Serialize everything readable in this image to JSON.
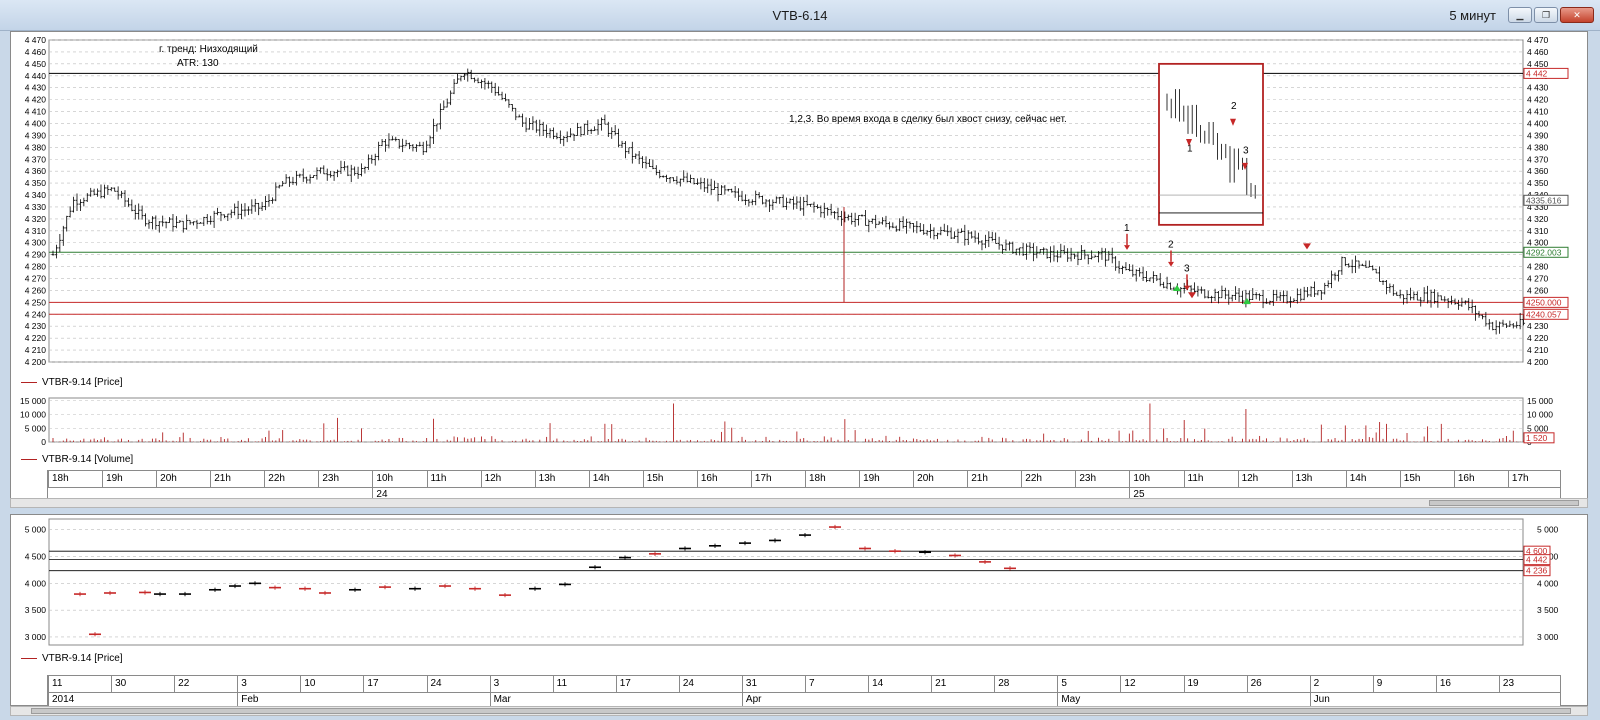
{
  "window": {
    "title": "VTB-6.14",
    "period": "5 минут",
    "controls": [
      "minimize",
      "maximize",
      "close"
    ]
  },
  "main_chart": {
    "annotation_trend": "г. тренд: Низходящий",
    "annotation_atr": "ATR: 130",
    "annotation_note": "1,2,3. Во время входа в сделку был хвост снизу, сейчас нет.",
    "legend_label": "VTBR-9.14 [Price]",
    "series_color": "#000000",
    "line_color": "#b22222",
    "y_ticks": [
      4200,
      4210,
      4220,
      4230,
      4240,
      4250,
      4260,
      4270,
      4280,
      4290,
      4300,
      4310,
      4320,
      4330,
      4340,
      4350,
      4360,
      4370,
      4380,
      4390,
      4400,
      4410,
      4420,
      4430,
      4440,
      4450,
      4460,
      4470
    ],
    "y_tick_labels": [
      "4 200",
      "4 210",
      "4 220",
      "4 230",
      "4 240",
      "4 250",
      "4 260",
      "4 270",
      "4 280",
      "4 290",
      "4 300",
      "4 310",
      "4 320",
      "4 330",
      "4 340",
      "4 350",
      "4 360",
      "4 370",
      "4 380",
      "4 390",
      "4 400",
      "4 410",
      "4 420",
      "4 430",
      "4 440",
      "4 450",
      "4 460",
      "4 470"
    ],
    "price_badges": [
      {
        "label": "4 442",
        "value": 4442,
        "color": "#c62828"
      },
      {
        "label": "4335.616",
        "value": 4335.6,
        "color": "#555555"
      },
      {
        "label": "4292.003",
        "value": 4292,
        "color": "#2e7d32"
      },
      {
        "label": "4250.000",
        "value": 4250,
        "color": "#c62828"
      },
      {
        "label": "4240.057",
        "value": 4240,
        "color": "#c62828"
      }
    ],
    "horizontal_lines": [
      {
        "value": 4442,
        "color": "#000000"
      },
      {
        "value": 4292,
        "color": "#2e7d32"
      },
      {
        "value": 4250,
        "color": "#c62828"
      },
      {
        "value": 4240,
        "color": "#c62828"
      }
    ],
    "markers": [
      "1",
      "2",
      "3"
    ],
    "inset_markers": [
      "1",
      "2",
      "3"
    ]
  },
  "volume_chart": {
    "legend_label": "VTBR-9.14 [Volume]",
    "y_tick_labels": [
      "0",
      "5 000",
      "10 000",
      "15 000"
    ],
    "y_ticks": [
      0,
      5000,
      10000,
      15000
    ],
    "badge": "1 520",
    "badge_value": 1520
  },
  "intraday_axis": {
    "hours": [
      "18h",
      "19h",
      "20h",
      "21h",
      "22h",
      "23h",
      "10h",
      "11h",
      "12h",
      "13h",
      "14h",
      "15h",
      "16h",
      "17h",
      "18h",
      "19h",
      "20h",
      "21h",
      "22h",
      "23h",
      "10h",
      "11h",
      "12h",
      "13h",
      "14h",
      "15h",
      "16h",
      "17h"
    ],
    "days": [
      "24",
      "25"
    ]
  },
  "daily_chart": {
    "legend_label": "VTBR-9.14 [Price]",
    "y_ticks": [
      3000,
      3500,
      4000,
      4500,
      5000
    ],
    "y_tick_labels": [
      "3 000",
      "3 500",
      "4 000",
      "4 500",
      "5 000"
    ],
    "badges": [
      {
        "label": "4 600",
        "value": 4600
      },
      {
        "label": "4 442",
        "value": 4442
      },
      {
        "label": "4 236",
        "value": 4236
      }
    ]
  },
  "daily_axis": {
    "days": [
      "11",
      "30",
      "22",
      "3",
      "10",
      "17",
      "24",
      "3",
      "11",
      "17",
      "24",
      "31",
      "7",
      "14",
      "21",
      "28",
      "5",
      "12",
      "19",
      "26",
      "2",
      "9",
      "16",
      "23"
    ],
    "months": [
      "2014",
      "Feb",
      "Mar",
      "Apr",
      "May",
      "Jun"
    ]
  }
}
